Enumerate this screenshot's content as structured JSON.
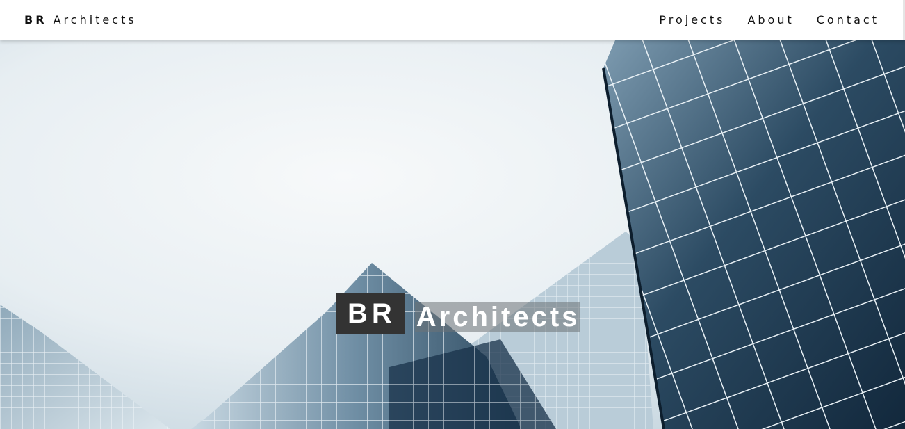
{
  "nav": {
    "brand_bold": "BR",
    "brand_rest": " Architects",
    "links": [
      "Projects",
      "About",
      "Contact"
    ]
  },
  "hero": {
    "title_bold": "BR",
    "title_rest": "Architects",
    "image": "glass-office-buildings-photo"
  },
  "colors": {
    "title_box": "#333333",
    "sky": "#eef3f6",
    "glass_dark": "#1f3a52"
  }
}
